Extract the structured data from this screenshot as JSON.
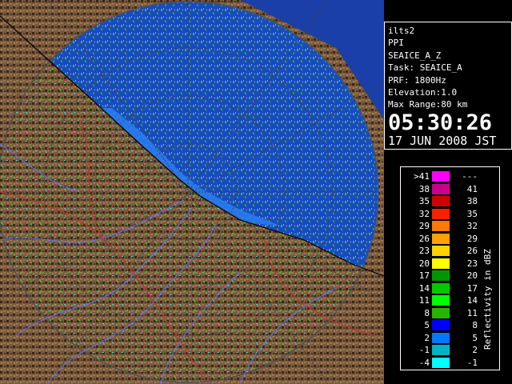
{
  "panel": {
    "site": "ilts2",
    "product": "PPI",
    "scan": "SEAICE_A_Z",
    "task": "Task: SEAICE_A",
    "prf": "PRF: 1800Hz",
    "elevation": "Elevation:1.0",
    "max_range": "Max Range:80 km",
    "time": "05:30:26",
    "date": "17 JUN 2008 JST"
  },
  "legend": {
    "unit_label": "Reflectivity in dBZ",
    "rows": [
      {
        "lo": ">41",
        "hi": "---",
        "color": "#ff00ff"
      },
      {
        "lo": "38",
        "hi": "41",
        "color": "#c8008c"
      },
      {
        "lo": "35",
        "hi": "38",
        "color": "#d00000"
      },
      {
        "lo": "32",
        "hi": "35",
        "color": "#ff1e00"
      },
      {
        "lo": "29",
        "hi": "32",
        "color": "#ff7800"
      },
      {
        "lo": "26",
        "hi": "29",
        "color": "#ffa000"
      },
      {
        "lo": "23",
        "hi": "26",
        "color": "#ffd200"
      },
      {
        "lo": "20",
        "hi": "23",
        "color": "#ffff00"
      },
      {
        "lo": "17",
        "hi": "20",
        "color": "#009600"
      },
      {
        "lo": "14",
        "hi": "17",
        "color": "#00c800"
      },
      {
        "lo": "11",
        "hi": "14",
        "color": "#00ff00"
      },
      {
        "lo": "8",
        "hi": "11",
        "color": "#28b400"
      },
      {
        "lo": "5",
        "hi": "8",
        "color": "#0000ff"
      },
      {
        "lo": "2",
        "hi": "5",
        "color": "#0078ff"
      },
      {
        "lo": "-1",
        "hi": "2",
        "color": "#00b4c8"
      },
      {
        "lo": "-4",
        "hi": "-1",
        "color": "#00ffff"
      }
    ]
  },
  "map_colors": {
    "sea": "#1e4bd2",
    "sea_light": "#2a7cf0",
    "land": "#7a5a3e",
    "land_dark": "#3a2716",
    "echo_green": "#2ec81e",
    "echo_cyan": "#3cd2d2",
    "rings": "#404040"
  }
}
